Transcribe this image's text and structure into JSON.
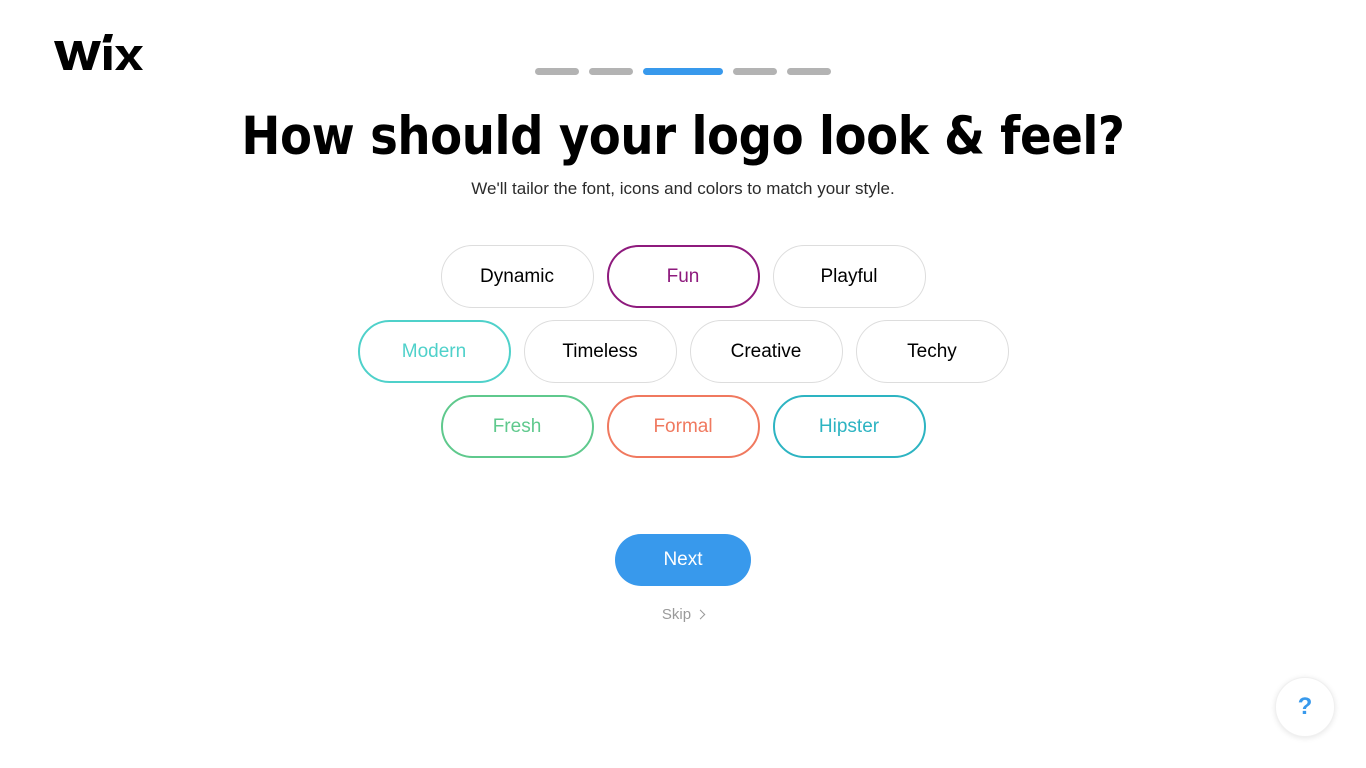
{
  "brand": {
    "logo_text": "WiX",
    "logo_name": "wix-logo"
  },
  "progress": {
    "total_steps": 5,
    "current_step": 3,
    "active_color": "#3899ec",
    "inactive_color": "#b3b3b3",
    "steps": [
      {
        "index": 1,
        "active": false
      },
      {
        "index": 2,
        "active": false
      },
      {
        "index": 3,
        "active": true
      },
      {
        "index": 4,
        "active": false
      },
      {
        "index": 5,
        "active": false
      }
    ]
  },
  "header": {
    "title": "How should your logo look & feel?",
    "subtitle": "We'll tailor the font, icons and colors to match your style."
  },
  "chips": {
    "rows": [
      [
        {
          "label": "Dynamic",
          "color": "#000000",
          "border": "#dddddd",
          "selected": false
        },
        {
          "label": "Fun",
          "color": "#8e1a7d",
          "border": "#8e1a7d",
          "selected": true
        },
        {
          "label": "Playful",
          "color": "#000000",
          "border": "#dddddd",
          "selected": false
        }
      ],
      [
        {
          "label": "Modern",
          "color": "#4fd1ca",
          "border": "#4fd1ca",
          "selected": true
        },
        {
          "label": "Timeless",
          "color": "#000000",
          "border": "#dddddd",
          "selected": false
        },
        {
          "label": "Creative",
          "color": "#000000",
          "border": "#dddddd",
          "selected": false
        },
        {
          "label": "Techy",
          "color": "#000000",
          "border": "#dddddd",
          "selected": false
        }
      ],
      [
        {
          "label": "Fresh",
          "color": "#5fc98d",
          "border": "#5fc98d",
          "selected": true
        },
        {
          "label": "Formal",
          "color": "#f0795f",
          "border": "#f0795f",
          "selected": true
        },
        {
          "label": "Hipster",
          "color": "#2db4c2",
          "border": "#2db4c2",
          "selected": true
        }
      ]
    ]
  },
  "actions": {
    "next_label": "Next",
    "next_color": "#3899ec",
    "skip_label": "Skip",
    "skip_icon": "chevron-right-icon"
  },
  "help": {
    "label": "?",
    "icon": "question-mark-icon",
    "color": "#3899ec"
  }
}
